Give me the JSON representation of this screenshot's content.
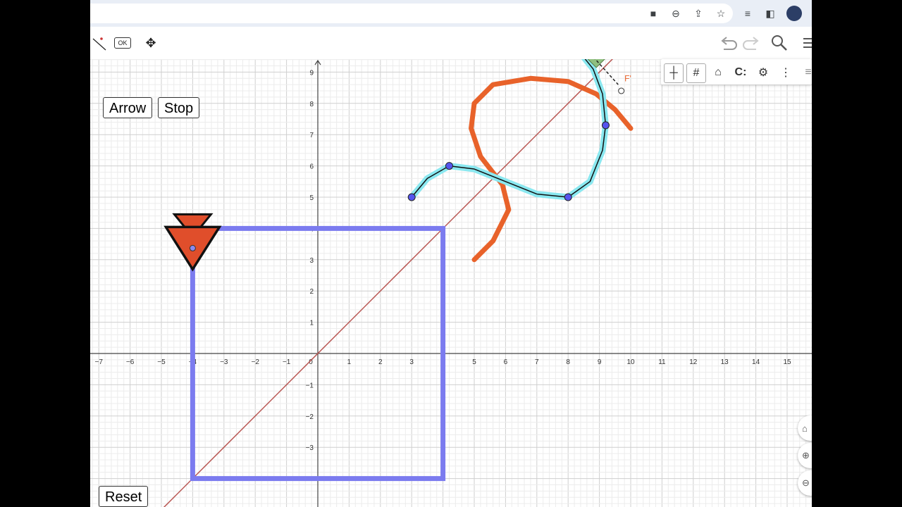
{
  "browser": {
    "icons": [
      "camera-icon",
      "zoom-icon",
      "share-icon",
      "star-icon",
      "reading-list-icon",
      "sidepanel-icon",
      "profile-avatar"
    ]
  },
  "toolbar": {
    "ok_label": "OK",
    "tools": [
      "line-tool-icon",
      "ok-checkbox-tool",
      "move-graphics-icon"
    ],
    "right": [
      "undo-icon",
      "redo-icon",
      "search-icon",
      "menu-icon"
    ]
  },
  "stylebar": {
    "buttons": [
      "axes-icon",
      "grid-icon",
      "home-icon",
      "magnet-icon",
      "settings-icon",
      "more-icon"
    ]
  },
  "buttons": {
    "arrow": "Arrow",
    "stop": "Stop",
    "reset": "Reset"
  },
  "axes": {
    "x_ticks": [
      "−7",
      "−6",
      "−5",
      "−4",
      "−3",
      "−2",
      "−1",
      "0",
      "1",
      "2",
      "3",
      "4",
      "5",
      "6",
      "7",
      "8",
      "9",
      "10",
      "11",
      "12",
      "13",
      "14",
      "15"
    ],
    "y_ticks": [
      "9",
      "8",
      "7",
      "6",
      "5",
      "4",
      "3",
      "2",
      "1",
      "−1",
      "−2",
      "−3"
    ]
  },
  "labels": {
    "point_F": "F'"
  },
  "colors": {
    "square": "#7b7bef",
    "diagonal": "#b85450",
    "curve_orange": "#e8622a",
    "curve_cyan": "#8ae8f0",
    "point": "#5555ee",
    "arrow_fill": "#e04e2b",
    "right_angle": "#8fbf7f"
  },
  "zoom_controls": [
    "home-zoom-icon",
    "zoom-in-icon",
    "zoom-out-icon"
  ]
}
